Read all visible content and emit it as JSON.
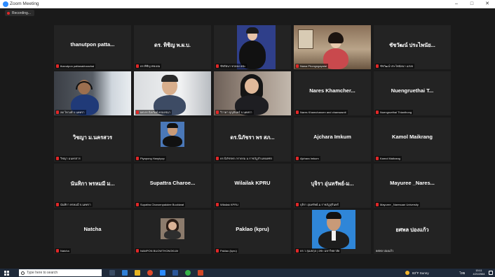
{
  "window": {
    "title": "Zoom Meeting",
    "minimize": "–",
    "maximize": "□",
    "close": "✕"
  },
  "recording": {
    "label": "Recording..."
  },
  "tiles": [
    {
      "big": "thanutpon patta...",
      "label": "thanutpon pattanakhanchai"
    },
    {
      "big": "ดร. ทิชิญ พ.ผ.บ.",
      "label": "ดร.ทิชิญ ทพ.ผณ"
    },
    {
      "big": "",
      "label": "ชัชรัตนา ทวยอง อชะ"
    },
    {
      "big": "",
      "label": "Nawa Phongngayaiai"
    },
    {
      "big": "ชัชวัฒน์ ประไพนัย...",
      "label": "ชัชวัฒน์ ประไพนัยนา แสงจ"
    },
    {
      "big": "",
      "label": "ลด ไทวงศ์ จ.นคทรา"
    },
    {
      "big": "",
      "label": "ผศ.ดร.นิลภันท์ ครองชนา"
    },
    {
      "big": "",
      "label": "วิวาดา บุญจันทร์ จ.นคทรา"
    },
    {
      "big": "Nares Khamcher...",
      "label": "Nares Khamcharoen and chanwasnit"
    },
    {
      "big": "Nuengruethai T...",
      "label": "Nuengruethai Thianthong"
    },
    {
      "big": "วิชญา ม.นครสวร",
      "label": "วิชญา มนครสวร"
    },
    {
      "big": "",
      "label": "Piyapong Hanpiyop"
    },
    {
      "big": "ดร.นิภัชรา พร สภ...",
      "label": "ดร.นิภัชรพร ภราดรม ม.ราชภัฏกำแพงเพชร"
    },
    {
      "big": "Ajchara Imkum",
      "label": "Ajchara Imkum"
    },
    {
      "big": "Kamol Maikrang",
      "label": "Kamol Maikrang"
    },
    {
      "big": "นันทิกา พรหมมี ม...",
      "label": "นันทิกา พรหมมี จ.นคทรา"
    },
    {
      "big": "Supattra Charoe...",
      "label": "Supattra Charoenpakdee Bucktwat"
    },
    {
      "big": "Wilailak KPRU",
      "label": "Wilailak KPRU"
    },
    {
      "big": "บุจิรา อุ่นทรัพย์-ม...",
      "label": "บุจิรา อุ่นทรัพย์-ม.ราชภัฏสุรินทร์"
    },
    {
      "big": "Mayuree _Nares...",
      "label": "Mayuree _Naresuan University"
    },
    {
      "big": "Natcha",
      "label": "Natcha"
    },
    {
      "big": "",
      "label": "NAMPON BUOWTHONGKUM"
    },
    {
      "big": "Paklao (kpru)",
      "label": "Paklao (kpru)"
    },
    {
      "big": "",
      "label": "ดร.ว สุเมธกุล | อชะ มหาวิทยาลัย"
    },
    {
      "big": "ยศพล ปองแก้ว",
      "label": "ยศพล ปองแก้ว"
    }
  ],
  "taskbar": {
    "search_placeholder": "Type here to search",
    "weather": "83°F  Sunny",
    "tray_lang": "ไทย",
    "time": "15:11",
    "date": "4/21/2564"
  },
  "icons": {
    "start": "windows-start-icon",
    "search": "search-icon",
    "mic_muted": "mic-muted-icon"
  },
  "colors": {
    "active_speaker": "#c8e06b",
    "tile_bg": "#232323",
    "taskbar": "#1f2a3a",
    "muted": "#e02828"
  }
}
